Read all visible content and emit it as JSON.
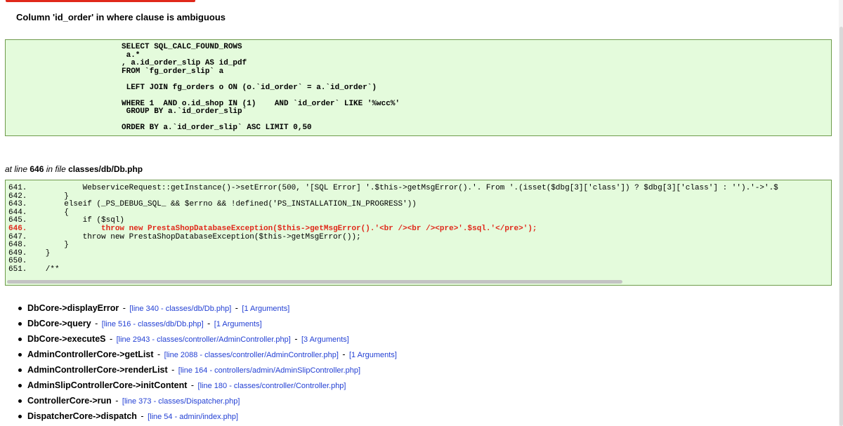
{
  "error": {
    "message": "Column 'id_order' in where clause is ambiguous",
    "sql": "SELECT SQL_CALC_FOUND_ROWS\n a.*\n, a.id_order_slip AS id_pdf\nFROM `fg_order_slip` a\n\n LEFT JOIN fg_orders o ON (o.`id_order` = a.`id_order`)\n\nWHERE 1  AND o.id_shop IN (1)    AND `id_order` LIKE '%wcc%'\n GROUP BY a.`id_order_slip`\n\nORDER BY a.`id_order_slip` ASC LIMIT 0,50"
  },
  "location": {
    "prefix": "at line",
    "line": "646",
    "mid": "in file",
    "file": "classes/db/Db.php"
  },
  "code": [
    {
      "text": "641.            WebserviceRequest::getInstance()->setError(500, '[SQL Error] '.$this->getMsgError().'. From '.(isset($dbg[3]['class']) ? $dbg[3]['class'] : '').'->'.$",
      "highlight": false
    },
    {
      "text": "642.        }",
      "highlight": false
    },
    {
      "text": "643.        elseif (_PS_DEBUG_SQL_ && $errno && !defined('PS_INSTALLATION_IN_PROGRESS'))",
      "highlight": false
    },
    {
      "text": "644.        {",
      "highlight": false
    },
    {
      "text": "645.            if ($sql)",
      "highlight": false
    },
    {
      "text": "646.                throw new PrestaShopDatabaseException($this->getMsgError().'<br /><br /><pre>'.$sql.'</pre>');",
      "highlight": true
    },
    {
      "text": "647.            throw new PrestaShopDatabaseException($this->getMsgError());",
      "highlight": false
    },
    {
      "text": "648.        }",
      "highlight": false
    },
    {
      "text": "649.    }",
      "highlight": false
    },
    {
      "text": "650.",
      "highlight": false
    },
    {
      "text": "651.    /**",
      "highlight": false
    }
  ],
  "trace": [
    {
      "fn": "DbCore->displayError",
      "loc": "[line 340 - classes/db/Db.php]",
      "args": "[1 Arguments]"
    },
    {
      "fn": "DbCore->query",
      "loc": "[line 516 - classes/db/Db.php]",
      "args": "[1 Arguments]"
    },
    {
      "fn": "DbCore->executeS",
      "loc": "[line 2943 - classes/controller/AdminController.php]",
      "args": "[3 Arguments]"
    },
    {
      "fn": "AdminControllerCore->getList",
      "loc": "[line 2088 - classes/controller/AdminController.php]",
      "args": "[1 Arguments]"
    },
    {
      "fn": "AdminControllerCore->renderList",
      "loc": "[line 164 - controllers/admin/AdminSlipController.php]",
      "args": ""
    },
    {
      "fn": "AdminSlipControllerCore->initContent",
      "loc": "[line 180 - classes/controller/Controller.php]",
      "args": ""
    },
    {
      "fn": "ControllerCore->run",
      "loc": "[line 373 - classes/Dispatcher.php]",
      "args": ""
    },
    {
      "fn": "DispatcherCore->dispatch",
      "loc": "[line 54 - admin/index.php]",
      "args": ""
    }
  ]
}
